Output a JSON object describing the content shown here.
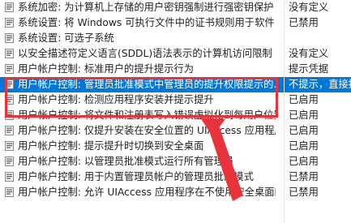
{
  "policies": [
    {
      "name": "系统加密: 为计算机上存储的用户密钥强制进行强密钥保护",
      "setting": "没有定义",
      "selected": false
    },
    {
      "name": "系统设置: 将 Windows 可执行文件中的证书规则用于软件...",
      "setting": "已禁用",
      "selected": false
    },
    {
      "name": "系统设置: 可选子系统",
      "setting": "",
      "selected": false
    },
    {
      "name": "以安全描述符定义语言(SDDL)语法表示的计算机访问限制",
      "setting": "没有定义",
      "selected": false
    },
    {
      "name": "用户帐户控制: 标准用户的提升提示行为",
      "setting": "提示凭据",
      "selected": false
    },
    {
      "name": "用户帐户控制: 管理员批准模式中管理员的提升权限提示的...",
      "setting": "不提示，直接提升",
      "selected": true
    },
    {
      "name": "用户帐户控制: 检测应用程序安装并提示提升",
      "setting": "已启用",
      "selected": false
    },
    {
      "name": "用户帐户控制: 将文件和注册表写入错误虚拟化到每用户位置",
      "setting": "已启用",
      "selected": false
    },
    {
      "name": "用户帐户控制: 仅提升安装在安全位置的 UIAccess 应用程序",
      "setting": "已启用",
      "selected": false
    },
    {
      "name": "用户帐户控制: 提示提升时切换到安全桌面",
      "setting": "已启用",
      "selected": false
    },
    {
      "name": "用户帐户控制: 以管理员批准模式运行所有管理员",
      "setting": "已启用",
      "selected": false
    },
    {
      "name": "用户帐户控制: 用于内置管理员帐户的管理员批准模式",
      "setting": "已禁用",
      "selected": false
    },
    {
      "name": "用户帐户控制: 允许 UIAccess 应用程序在不使用安全桌面的...",
      "setting": "已禁用",
      "selected": false
    }
  ],
  "colors": {
    "selection": "#0078d7",
    "annotation": "#e8323c"
  },
  "icons": {
    "policy_icon": "policy-setting-icon",
    "annotation_arrow": "red-arrow-icon"
  }
}
